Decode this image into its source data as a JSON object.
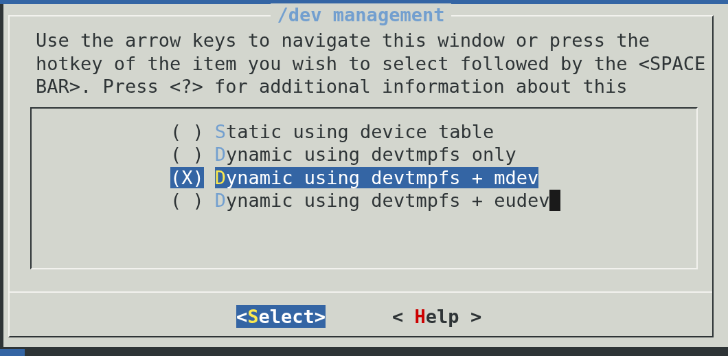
{
  "dialog": {
    "title": "/dev management",
    "description": [
      "Use the arrow keys to navigate this window or press the",
      "hotkey of the item you wish to select followed by the <SPACE",
      "BAR>. Press <?> for additional information about this"
    ],
    "options": [
      {
        "mark": "( )",
        "hotkey": "S",
        "rest": "tatic using device table",
        "selected": false,
        "cursor": false
      },
      {
        "mark": "( )",
        "hotkey": "D",
        "rest": "ynamic using devtmpfs only",
        "selected": false,
        "cursor": false
      },
      {
        "mark": "(X)",
        "hotkey": "D",
        "rest": "ynamic using devtmpfs + mdev",
        "selected": true,
        "cursor": false
      },
      {
        "mark": "( )",
        "hotkey": "D",
        "rest": "ynamic using devtmpfs + eudev",
        "selected": false,
        "cursor": true
      }
    ],
    "buttons": [
      {
        "prefix": "<",
        "hotkey": "S",
        "rest": "elect>",
        "selected": true
      },
      {
        "prefix": "< ",
        "hotkey": "H",
        "rest": "elp >",
        "selected": false
      }
    ]
  }
}
